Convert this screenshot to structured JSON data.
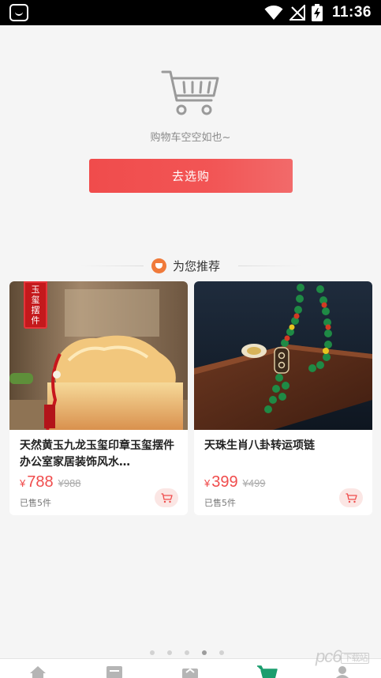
{
  "status_bar": {
    "time": "11:36",
    "icons": [
      "app-notification-icon",
      "wifi-icon",
      "no-signal-icon",
      "battery-charging-icon"
    ]
  },
  "empty_cart": {
    "icon": "shopping-cart-icon",
    "message": "购物车空空如也~",
    "button_label": "去选购",
    "accent_color": "#f04c4c"
  },
  "recommend": {
    "title": "为您推荐",
    "icon": "heart-badge-icon",
    "badge_color": "#f07a3a"
  },
  "products": [
    {
      "title": "天然黄玉九龙玉玺印章玉玺摆件办公室家居装饰风水…",
      "tag_text": "玉玺摆件",
      "currency": "¥",
      "price": "788",
      "original_price": "¥988",
      "sold": "已售5件"
    },
    {
      "title": "天珠生肖八卦转运项链",
      "currency": "¥",
      "price": "399",
      "original_price": "¥499",
      "sold": "已售5件"
    }
  ],
  "pager": {
    "count": 5,
    "active_index": 3
  },
  "tab_bar": {
    "tabs": [
      {
        "icon": "home-icon"
      },
      {
        "icon": "list-icon"
      },
      {
        "icon": "gift-box-icon"
      },
      {
        "icon": "shopping-cart-icon",
        "active": true,
        "active_color": "#1a9e6e"
      },
      {
        "icon": "user-icon"
      }
    ]
  },
  "watermark": {
    "text": "pc6",
    "suffix": "下载站"
  }
}
